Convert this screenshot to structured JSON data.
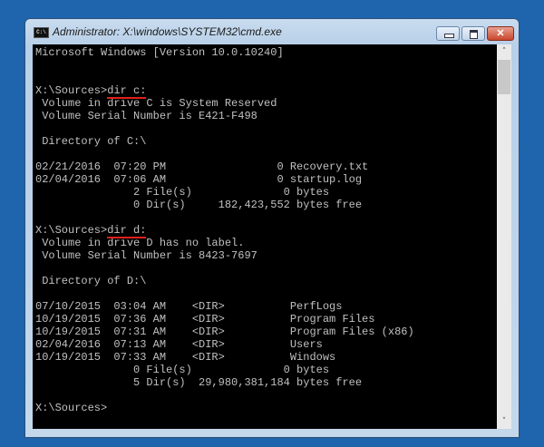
{
  "window": {
    "title": "Administrator: X:\\windows\\SYSTEM32\\cmd.exe",
    "icon_text": "C:\\",
    "close_glyph": "✕",
    "scroll_up": "˄",
    "scroll_down": "˅"
  },
  "console": {
    "lines": [
      "Microsoft Windows [Version 10.0.10240]",
      "",
      "",
      "X:\\Sources>",
      " Volume in drive C is System Reserved",
      " Volume Serial Number is E421-F498",
      "",
      " Directory of C:\\",
      "",
      "02/21/2016  07:20 PM                 0 Recovery.txt",
      "02/04/2016  07:06 AM                 0 startup.log",
      "               2 File(s)              0 bytes",
      "               0 Dir(s)     182,423,552 bytes free",
      "",
      "X:\\Sources>",
      " Volume in drive D has no label.",
      " Volume Serial Number is 8423-7697",
      "",
      " Directory of D:\\",
      "",
      "07/10/2015  03:04 AM    <DIR>          PerfLogs",
      "10/19/2015  07:36 AM    <DIR>          Program Files",
      "10/19/2015  07:31 AM    <DIR>          Program Files (x86)",
      "02/04/2016  07:13 AM    <DIR>          Users",
      "10/19/2015  07:33 AM    <DIR>          Windows",
      "               0 File(s)              0 bytes",
      "               5 Dir(s)  29,980,381,184 bytes free",
      "",
      "X:\\Sources>"
    ],
    "commands": {
      "3": "dir c:",
      "14": "dir d:"
    }
  }
}
